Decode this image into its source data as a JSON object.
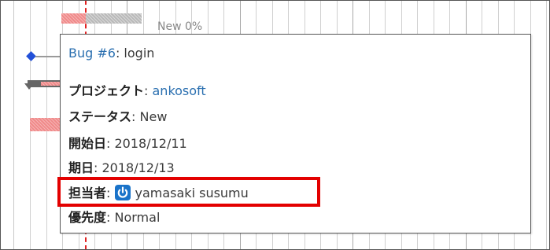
{
  "gantt": {
    "status_label": "New 0%",
    "colors": {
      "late": "#f08a8a",
      "todo": "#b9b9b9",
      "milestone": "#2250d8",
      "today_line": "#e02020",
      "parent": "#666666"
    }
  },
  "tooltip": {
    "issue_link": "Bug #6",
    "issue_subject": ": login",
    "separator": ": ",
    "fields": {
      "project": {
        "label": "プロジェクト",
        "value": "ankosoft"
      },
      "status": {
        "label": "ステータス",
        "value": "New"
      },
      "start_date": {
        "label": "開始日",
        "value": "2018/12/11"
      },
      "due_date": {
        "label": "期日",
        "value": "2018/12/13"
      },
      "assignee": {
        "label": "担当者",
        "value": "yamasaki susumu",
        "avatar_icon": "power-icon",
        "avatar_color": "#1a73c9"
      },
      "priority": {
        "label": "優先度",
        "value": "Normal"
      }
    },
    "highlight_color": "#e30000"
  }
}
